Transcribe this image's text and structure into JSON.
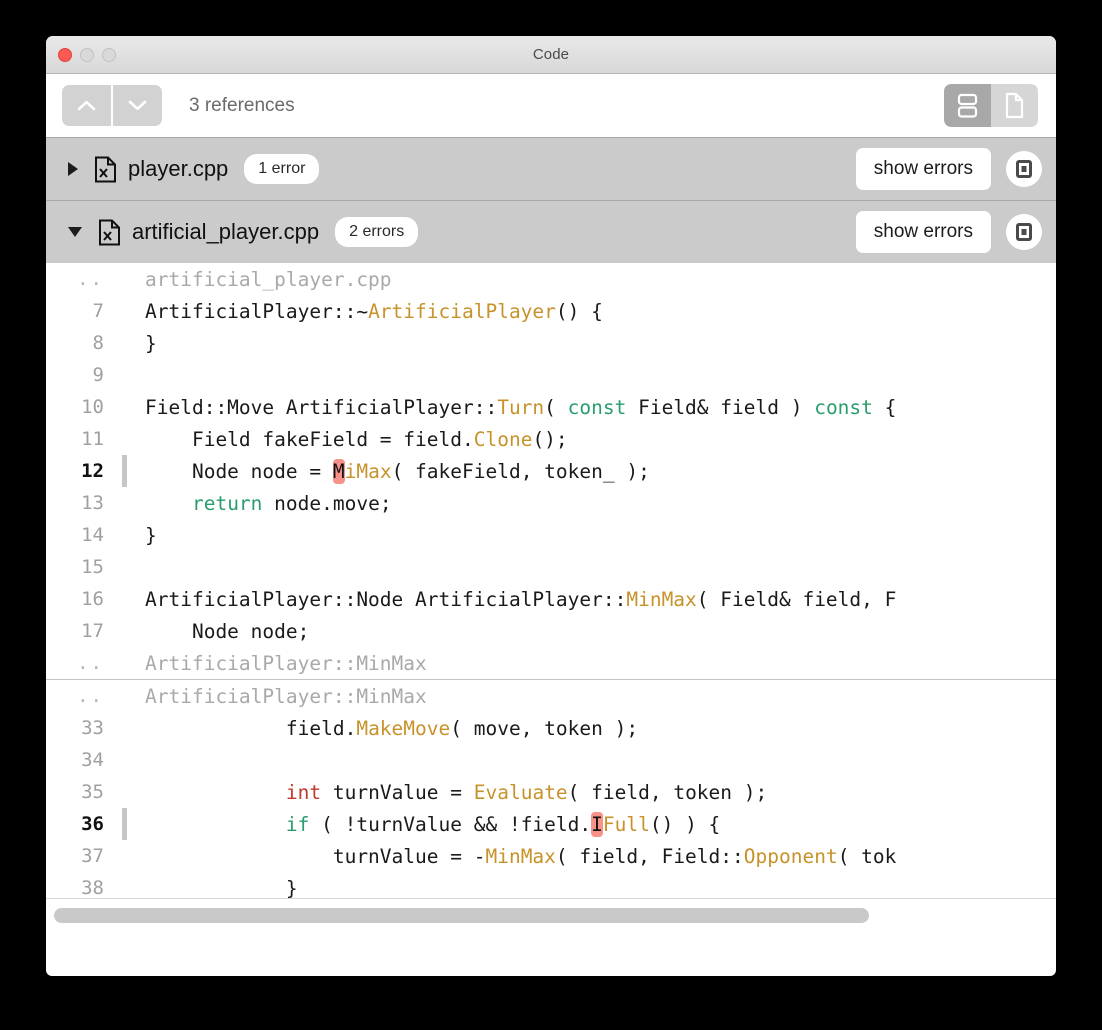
{
  "window": {
    "title": "Code",
    "traffic_lights": [
      "close-button",
      "minimize-button",
      "maximize-button"
    ]
  },
  "toolbar": {
    "prev_icon": "chevron-up-icon",
    "next_icon": "chevron-down-icon",
    "reference_count": "3 references",
    "view_split_icon": "split-view-icon",
    "view_single_icon": "single-document-icon",
    "view_selected": "split"
  },
  "files": [
    {
      "name": "player.cpp",
      "error_badge": "1 error",
      "expanded": false,
      "disclosure_icon": "disclosure-triangle-closed-icon",
      "file_icon": "cpp-file-icon",
      "show_errors_label": "show errors",
      "open_icon": "open-in-window-icon"
    },
    {
      "name": "artificial_player.cpp",
      "error_badge": "2 errors",
      "expanded": true,
      "disclosure_icon": "disclosure-triangle-open-icon",
      "file_icon": "cpp-file-icon",
      "show_errors_label": "show errors",
      "open_icon": "open-in-window-icon"
    }
  ],
  "colors": {
    "keyword": "#2a9d6e",
    "type": "#c0392b",
    "function": "#c8922b",
    "error_highlight": "#f79289",
    "text": "#1a1a1a",
    "context_text": "#a9a9a9",
    "row_background": "#cbcbcb"
  },
  "code": {
    "lines": [
      {
        "num": "..",
        "context": true,
        "current": false,
        "changed": false,
        "tokens": [
          {
            "t": "artificial_player.cpp",
            "c": ""
          }
        ]
      },
      {
        "num": "7",
        "context": false,
        "current": false,
        "changed": false,
        "tokens": [
          {
            "t": "ArtificialPlayer::~",
            "c": ""
          },
          {
            "t": "ArtificialPlayer",
            "c": "fn"
          },
          {
            "t": "() {",
            "c": ""
          }
        ]
      },
      {
        "num": "8",
        "context": false,
        "current": false,
        "changed": false,
        "tokens": [
          {
            "t": "}",
            "c": ""
          }
        ]
      },
      {
        "num": "9",
        "context": false,
        "current": false,
        "changed": false,
        "tokens": [
          {
            "t": "",
            "c": ""
          }
        ]
      },
      {
        "num": "10",
        "context": false,
        "current": false,
        "changed": false,
        "tokens": [
          {
            "t": "Field::Move ArtificialPlayer::",
            "c": ""
          },
          {
            "t": "Turn",
            "c": "fn"
          },
          {
            "t": "( ",
            "c": ""
          },
          {
            "t": "const",
            "c": "kw"
          },
          {
            "t": " Field& field ) ",
            "c": ""
          },
          {
            "t": "const",
            "c": "kw"
          },
          {
            "t": " {",
            "c": ""
          }
        ]
      },
      {
        "num": "11",
        "context": false,
        "current": false,
        "changed": false,
        "tokens": [
          {
            "t": "    Field fakeField = field.",
            "c": ""
          },
          {
            "t": "Clone",
            "c": "fn"
          },
          {
            "t": "();",
            "c": ""
          }
        ]
      },
      {
        "num": "12",
        "context": false,
        "current": true,
        "changed": true,
        "tokens": [
          {
            "t": "    Node node = ",
            "c": ""
          },
          {
            "t": "M",
            "c": "err"
          },
          {
            "t": "iMax",
            "c": "fn"
          },
          {
            "t": "( fakeField, token_ );",
            "c": ""
          }
        ]
      },
      {
        "num": "13",
        "context": false,
        "current": false,
        "changed": false,
        "tokens": [
          {
            "t": "    ",
            "c": ""
          },
          {
            "t": "return",
            "c": "kw"
          },
          {
            "t": " node.move;",
            "c": ""
          }
        ]
      },
      {
        "num": "14",
        "context": false,
        "current": false,
        "changed": false,
        "tokens": [
          {
            "t": "}",
            "c": ""
          }
        ]
      },
      {
        "num": "15",
        "context": false,
        "current": false,
        "changed": false,
        "tokens": [
          {
            "t": "",
            "c": ""
          }
        ]
      },
      {
        "num": "16",
        "context": false,
        "current": false,
        "changed": false,
        "tokens": [
          {
            "t": "ArtificialPlayer::Node ArtificialPlayer::",
            "c": ""
          },
          {
            "t": "MinMax",
            "c": "fn"
          },
          {
            "t": "( Field& field, F",
            "c": ""
          }
        ]
      },
      {
        "num": "17",
        "context": false,
        "current": false,
        "changed": false,
        "tokens": [
          {
            "t": "    Node node;",
            "c": ""
          }
        ]
      },
      {
        "num": "..",
        "context": true,
        "current": false,
        "changed": false,
        "tokens": [
          {
            "t": "ArtificialPlayer::MinMax",
            "c": ""
          }
        ]
      },
      {
        "num": "..",
        "context": true,
        "current": false,
        "changed": false,
        "separator_above": true,
        "tokens": [
          {
            "t": "ArtificialPlayer::MinMax",
            "c": ""
          }
        ]
      },
      {
        "num": "33",
        "context": false,
        "current": false,
        "changed": false,
        "tokens": [
          {
            "t": "            field.",
            "c": ""
          },
          {
            "t": "MakeMove",
            "c": "fn"
          },
          {
            "t": "( move, token );",
            "c": ""
          }
        ]
      },
      {
        "num": "34",
        "context": false,
        "current": false,
        "changed": false,
        "tokens": [
          {
            "t": "",
            "c": ""
          }
        ]
      },
      {
        "num": "35",
        "context": false,
        "current": false,
        "changed": false,
        "tokens": [
          {
            "t": "            ",
            "c": ""
          },
          {
            "t": "int",
            "c": "typ"
          },
          {
            "t": " turnValue = ",
            "c": ""
          },
          {
            "t": "Evaluate",
            "c": "fn"
          },
          {
            "t": "( field, token );",
            "c": ""
          }
        ]
      },
      {
        "num": "36",
        "context": false,
        "current": true,
        "changed": true,
        "tokens": [
          {
            "t": "            ",
            "c": ""
          },
          {
            "t": "if",
            "c": "kw"
          },
          {
            "t": " ( !turnValue && !field.",
            "c": ""
          },
          {
            "t": "I",
            "c": "err"
          },
          {
            "t": "Full",
            "c": "fn"
          },
          {
            "t": "() ) {",
            "c": ""
          }
        ]
      },
      {
        "num": "37",
        "context": false,
        "current": false,
        "changed": false,
        "tokens": [
          {
            "t": "                turnValue = -",
            "c": ""
          },
          {
            "t": "MinMax",
            "c": "fn"
          },
          {
            "t": "( field, Field::",
            "c": ""
          },
          {
            "t": "Opponent",
            "c": "fn"
          },
          {
            "t": "( tok",
            "c": ""
          }
        ]
      },
      {
        "num": "38",
        "context": false,
        "current": false,
        "changed": false,
        "tokens": [
          {
            "t": "            }",
            "c": ""
          }
        ]
      }
    ]
  },
  "scrollbar": {
    "orientation": "horizontal",
    "thumb_width_percent": 82
  }
}
